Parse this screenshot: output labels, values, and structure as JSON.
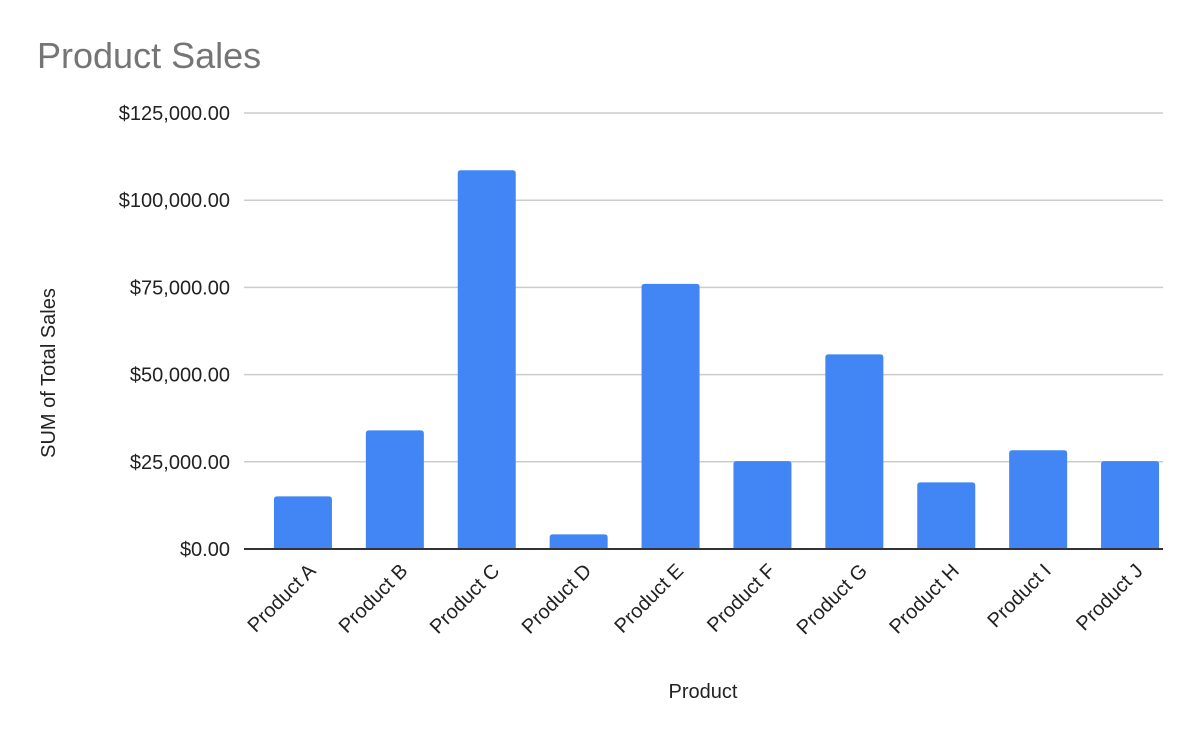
{
  "chart_data": {
    "type": "bar",
    "title": "Product Sales",
    "xlabel": "Product",
    "ylabel": "SUM of Total Sales",
    "categories": [
      "Product A",
      "Product B",
      "Product C",
      "Product D",
      "Product E",
      "Product F",
      "Product G",
      "Product H",
      "Product I",
      "Product J"
    ],
    "series": [
      {
        "name": "SUM of Total Sales",
        "color": "#4285f4",
        "values": [
          15100,
          34000,
          108600,
          4200,
          76000,
          25200,
          55800,
          19100,
          28300,
          25200
        ]
      }
    ],
    "ylim": [
      0,
      125000
    ],
    "yticks": [
      0,
      25000,
      50000,
      75000,
      100000,
      125000
    ],
    "ytick_labels": [
      "$0.00",
      "$25,000.00",
      "$50,000.00",
      "$75,000.00",
      "$100,000.00",
      "$125,000.00"
    ],
    "grid": true,
    "legend": "none"
  }
}
